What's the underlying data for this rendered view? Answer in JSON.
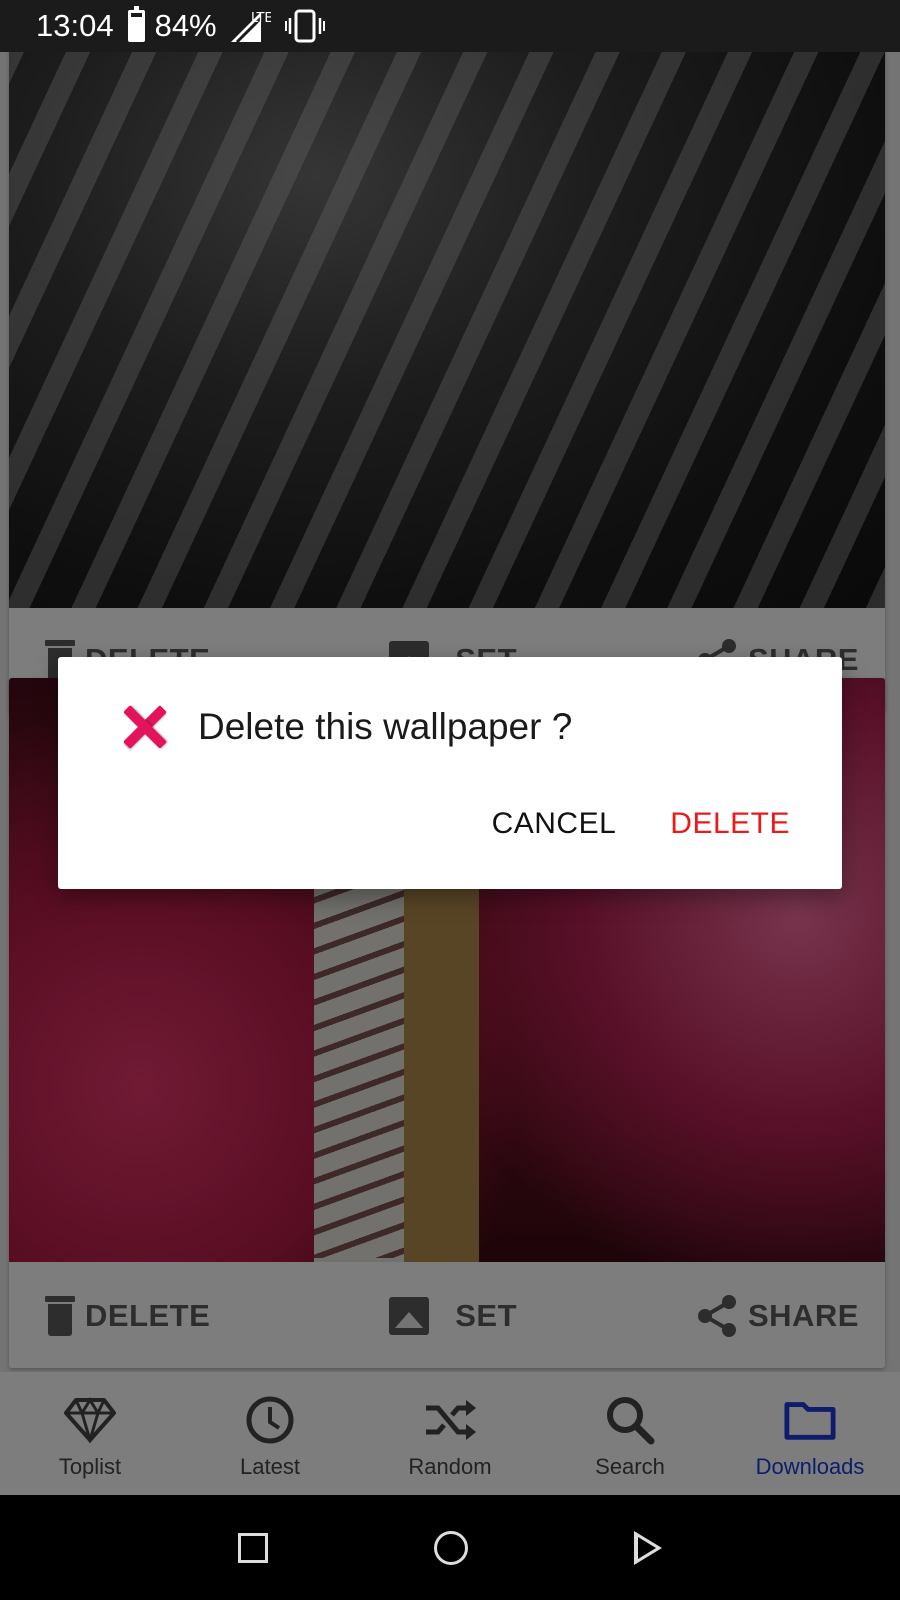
{
  "status_bar": {
    "time": "13:04",
    "battery_percent": "84%",
    "battery_level": 0.84,
    "network": "LTE",
    "icons": [
      "battery-icon",
      "signal-icon",
      "vibrate-icon"
    ]
  },
  "cards": [
    {
      "image": "black-and-white-tiger-wallpaper",
      "actions": {
        "delete_label": "DELETE",
        "set_label": "SET",
        "share_label": "SHARE"
      }
    },
    {
      "image": "white-tiger-climbing-rope-red-foliage-wallpaper",
      "actions": {
        "delete_label": "DELETE",
        "set_label": "SET",
        "share_label": "SHARE"
      }
    }
  ],
  "dialog": {
    "icon": "close-x-icon",
    "title": "Delete this wallpaper ?",
    "cancel_label": "CANCEL",
    "delete_label": "DELETE",
    "accent_color": "#e81a1a",
    "icon_color": "#e4145c"
  },
  "bottom_nav": {
    "active_color": "#1d3bd6",
    "items": [
      {
        "label": "Toplist",
        "icon": "diamond-icon",
        "active": false
      },
      {
        "label": "Latest",
        "icon": "clock-icon",
        "active": false
      },
      {
        "label": "Random",
        "icon": "shuffle-icon",
        "active": false
      },
      {
        "label": "Search",
        "icon": "search-icon",
        "active": false
      },
      {
        "label": "Downloads",
        "icon": "folder-icon",
        "active": true
      }
    ]
  },
  "system_nav": {
    "icons": [
      "recents-square-icon",
      "home-circle-icon",
      "back-triangle-icon"
    ]
  }
}
